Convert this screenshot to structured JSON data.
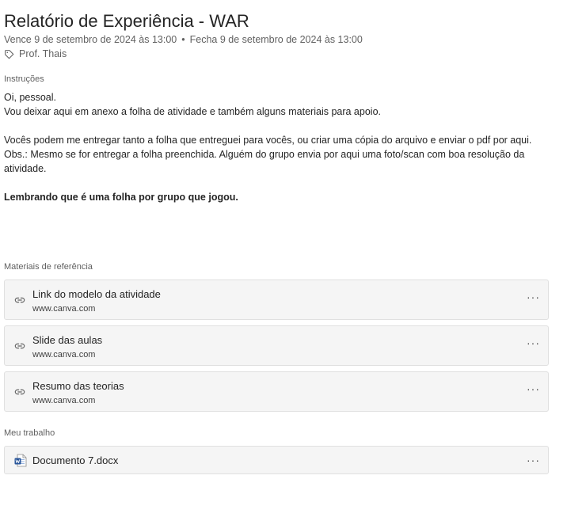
{
  "assignment": {
    "title": "Relatório de Experiência - WAR",
    "due": "Vence 9 de setembro de 2024 às 13:00",
    "separator": "•",
    "closes": "Fecha 9 de setembro de 2024 às 13:00",
    "teacher": "Prof. Thais"
  },
  "instructions": {
    "label": "Instruções",
    "line1": "Oi, pessoal.",
    "line2": "Vou deixar aqui em anexo a folha de atividade e também alguns materiais para apoio.",
    "line3": "Vocês podem me entregar tanto a folha que entreguei para vocês, ou criar uma cópia do arquivo e enviar o pdf por aqui.",
    "line4": "Obs.: Mesmo se for entregar a folha preenchida. Alguém do grupo envia por aqui uma foto/scan com boa resolução da atividade.",
    "line5": "Lembrando que é uma folha por grupo que jogou."
  },
  "references": {
    "label": "Materiais de referência",
    "items": [
      {
        "title": "Link do modelo da atividade",
        "url": "www.canva.com",
        "more": "···"
      },
      {
        "title": "Slide das aulas",
        "url": "www.canva.com",
        "more": "···"
      },
      {
        "title": "Resumo das teorias",
        "url": "www.canva.com",
        "more": "···"
      }
    ]
  },
  "my_work": {
    "label": "Meu trabalho",
    "file": {
      "name": "Documento 7.docx",
      "icon": "word-doc-icon",
      "more": "···"
    }
  },
  "colors": {
    "word_blue": "#2b579a",
    "card_bg": "#f5f5f5",
    "muted_text": "#616161"
  }
}
